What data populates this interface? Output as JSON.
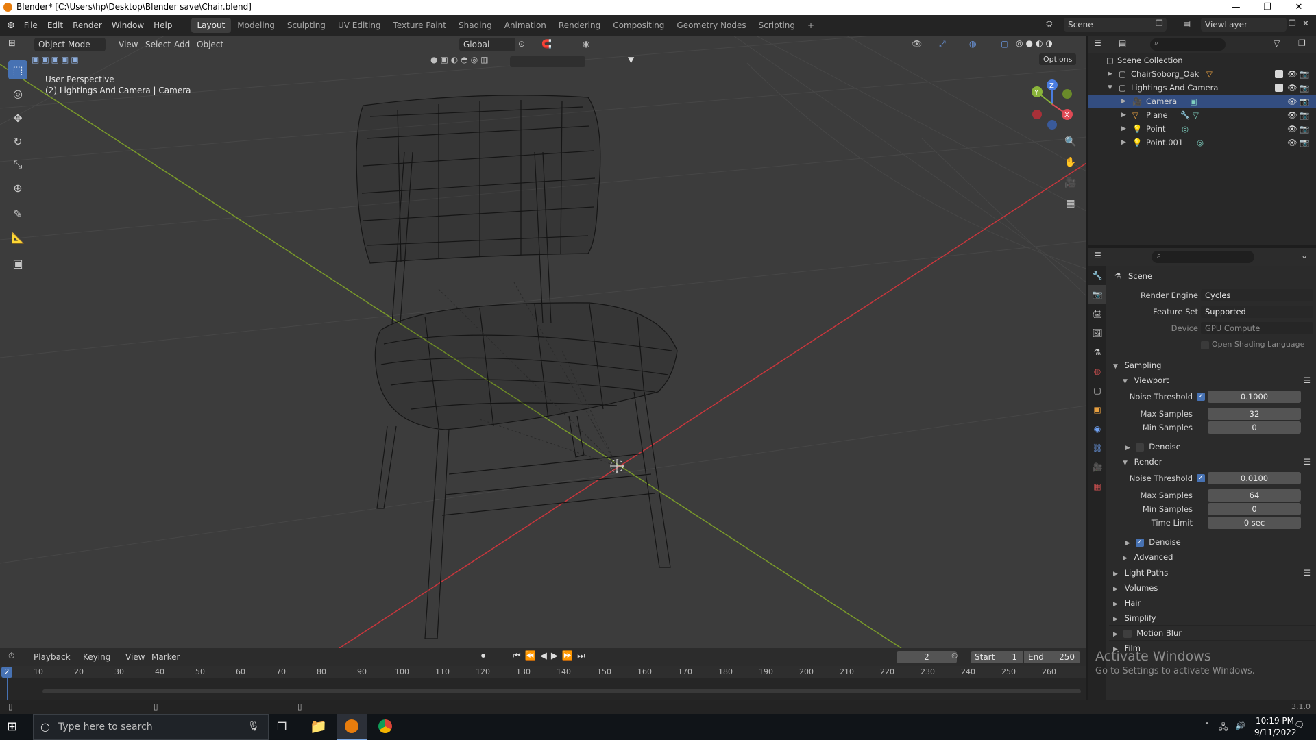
{
  "window": {
    "title": "Blender* [C:\\Users\\hp\\Desktop\\Blender save\\Chair.blend]",
    "minimize": "—",
    "maximize": "❐",
    "close": "✕"
  },
  "menu": [
    "File",
    "Edit",
    "Render",
    "Window",
    "Help"
  ],
  "workspaces": [
    "Layout",
    "Modeling",
    "Sculpting",
    "UV Editing",
    "Texture Paint",
    "Shading",
    "Animation",
    "Rendering",
    "Compositing",
    "Geometry Nodes",
    "Scripting"
  ],
  "add_workspace": "+",
  "scene_field": "Scene",
  "viewlayer_field": "ViewLayer",
  "viewport": {
    "mode": "Object Mode",
    "menus": [
      "View",
      "Select",
      "Add",
      "Object"
    ],
    "transform_orientation": "Global",
    "options_label": "Options",
    "overlay_line1": "User Perspective",
    "overlay_line2": "(2) Lightings And Camera | Camera",
    "gizmo_axes": [
      "Z",
      "Y",
      "X"
    ],
    "wire_color": "#151515",
    "x_axis_color": "#c8363c",
    "y_axis_color": "#7a9a2a"
  },
  "outliner": {
    "root": "Scene Collection",
    "items": [
      {
        "label": "ChairSoborg_Oak",
        "level": 1,
        "selected": false
      },
      {
        "label": "Lightings And Camera",
        "level": 1,
        "selected": false
      },
      {
        "label": "Camera",
        "level": 2,
        "selected": true
      },
      {
        "label": "Plane",
        "level": 2,
        "selected": false
      },
      {
        "label": "Point",
        "level": 2,
        "selected": false
      },
      {
        "label": "Point.001",
        "level": 2,
        "selected": false
      }
    ]
  },
  "properties": {
    "context": "Scene",
    "render_engine_label": "Render Engine",
    "render_engine": "Cycles",
    "feature_set_label": "Feature Set",
    "feature_set": "Supported",
    "device_label": "Device",
    "device": "GPU Compute",
    "osl_label": "Open Shading Language",
    "sampling": "Sampling",
    "viewport": {
      "title": "Viewport",
      "noise_threshold_label": "Noise Threshold",
      "noise_threshold": "0.1000",
      "max_samples_label": "Max Samples",
      "max_samples": "32",
      "min_samples_label": "Min Samples",
      "min_samples": "0",
      "denoise_label": "Denoise"
    },
    "render": {
      "title": "Render",
      "noise_threshold_label": "Noise Threshold",
      "noise_threshold": "0.0100",
      "max_samples_label": "Max Samples",
      "max_samples": "64",
      "min_samples_label": "Min Samples",
      "min_samples": "0",
      "time_limit_label": "Time Limit",
      "time_limit": "0 sec",
      "denoise_label": "Denoise"
    },
    "advanced": "Advanced",
    "panels": [
      "Light Paths",
      "Volumes",
      "Hair",
      "Simplify",
      "Motion Blur",
      "Film"
    ]
  },
  "timeline": {
    "menus": [
      "Playback",
      "Keying",
      "View",
      "Marker"
    ],
    "current_frame": "2",
    "start_label": "Start",
    "start": "1",
    "end_label": "End",
    "end": "250",
    "ruler": [
      "10",
      "20",
      "30",
      "40",
      "50",
      "60",
      "70",
      "80",
      "90",
      "100",
      "110",
      "120",
      "130",
      "140",
      "150",
      "160",
      "170",
      "180",
      "190",
      "200",
      "210",
      "220",
      "230",
      "240",
      "250",
      "260"
    ],
    "playhead_label": "2"
  },
  "watermark": {
    "line1": "Activate Windows",
    "line2": "Go to Settings to activate Windows."
  },
  "version": "3.1.0",
  "taskbar": {
    "search_placeholder": "Type here to search",
    "time": "10:19 PM",
    "date": "9/11/2022"
  }
}
